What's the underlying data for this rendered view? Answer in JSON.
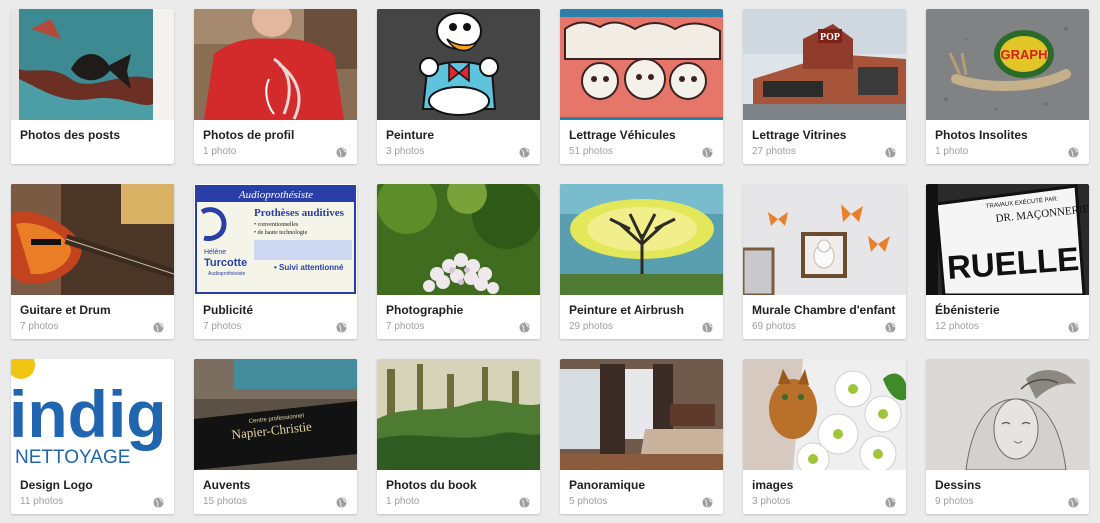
{
  "albums": [
    {
      "title": "Photos des posts",
      "count": "",
      "icon": "",
      "thumb": "painting-fish"
    },
    {
      "title": "Photos de profil",
      "count": "1 photo",
      "icon": "globe-icon",
      "thumb": "red-shirt"
    },
    {
      "title": "Peinture",
      "count": "3 photos",
      "icon": "globe-icon",
      "thumb": "duck-mural"
    },
    {
      "title": "Lettrage Véhicules",
      "count": "51 photos",
      "icon": "globe-icon",
      "thumb": "graffiti"
    },
    {
      "title": "Lettrage Vitrines",
      "count": "27 photos",
      "icon": "globe-icon",
      "thumb": "storefront"
    },
    {
      "title": "Photos Insolites",
      "count": "1 photo",
      "icon": "globe-icon",
      "thumb": "snail"
    },
    {
      "title": "Guitare et Drum",
      "count": "7 photos",
      "icon": "globe-icon",
      "thumb": "guitar"
    },
    {
      "title": "Publicité",
      "count": "7 photos",
      "icon": "globe-icon",
      "thumb": "ad-flyer"
    },
    {
      "title": "Photographie",
      "count": "7 photos",
      "icon": "globe-icon",
      "thumb": "flowers"
    },
    {
      "title": "Peinture et Airbrush",
      "count": "29 photos",
      "icon": "globe-icon",
      "thumb": "tree-painting"
    },
    {
      "title": "Murale Chambre d'enfant",
      "count": "69 photos",
      "icon": "globe-icon",
      "thumb": "butterflies-wall"
    },
    {
      "title": "Ébénisterie",
      "count": "12 photos",
      "icon": "globe-icon",
      "thumb": "sign-ruelle"
    },
    {
      "title": "Design Logo",
      "count": "11 photos",
      "icon": "globe-icon",
      "thumb": "logo-indig"
    },
    {
      "title": "Auvents",
      "count": "15 photos",
      "icon": "globe-icon",
      "thumb": "awning"
    },
    {
      "title": "Photos du book",
      "count": "1 photo",
      "icon": "globe-icon",
      "thumb": "forest"
    },
    {
      "title": "Panoramique",
      "count": "5 photos",
      "icon": "globe-icon",
      "thumb": "bedroom"
    },
    {
      "title": "images",
      "count": "3 photos",
      "icon": "globe-icon",
      "thumb": "cat-daisies"
    },
    {
      "title": "Dessins",
      "count": "9 photos",
      "icon": "globe-icon",
      "thumb": "pencil-drawing"
    }
  ],
  "thumb_text": {
    "ad_header": "Audioprothésiste",
    "ad_title": "Prothèses auditives",
    "ad_line1": "• conventionnelles",
    "ad_line2": "• de haute technologie",
    "ad_name1": "Hélène",
    "ad_name2": "Turcotte",
    "ad_role": "Audioprothésiste",
    "ad_line3": "• Suivi attentionné",
    "sign_top": "TRAVAUX EXÉCUTÉ PAR:",
    "sign_mid": "DR. MAÇONNERIE",
    "sign_big": "RUELLE",
    "logo_top": "indig",
    "logo_bottom": "NETTOYAGE",
    "awning_small": "Centre professionnel",
    "awning_big": "Napier-Christie",
    "store_sign": "POP",
    "snail_text": "GRAPH"
  }
}
